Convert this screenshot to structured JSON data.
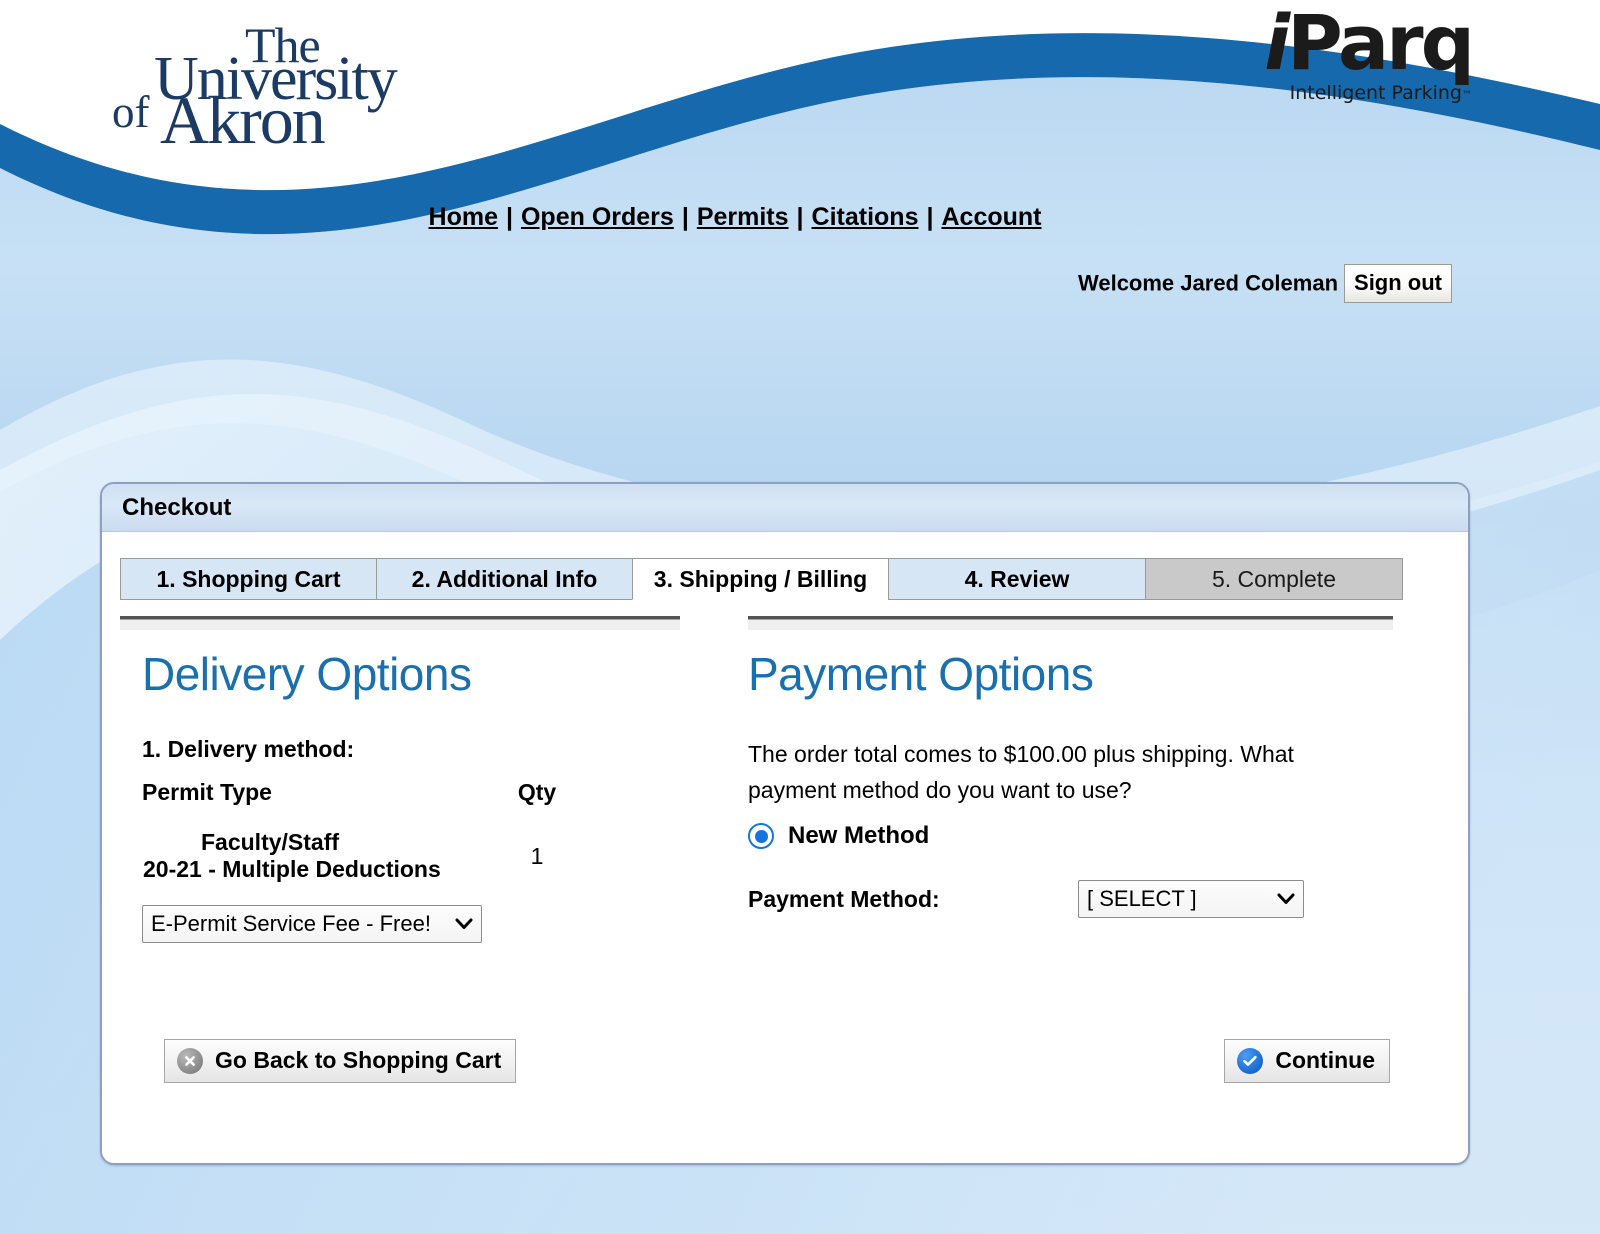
{
  "brand": {
    "university_logo": {
      "line1": "The",
      "line2": "University",
      "line3_of": "of",
      "line3": "Akron",
      "color": "#1b3a64"
    },
    "iparq_logo": {
      "name_i": "i",
      "name_rest": "Parq",
      "tagline": "Intelligent Parking",
      "tm": "™",
      "color": "#1b1b1b"
    }
  },
  "nav": {
    "separator": "|",
    "links": [
      {
        "label": "Home"
      },
      {
        "label": "Open Orders"
      },
      {
        "label": "Permits"
      },
      {
        "label": "Citations"
      },
      {
        "label": "Account"
      }
    ]
  },
  "account_bar": {
    "welcome": "Welcome Jared Coleman",
    "sign_out": "Sign out"
  },
  "panel": {
    "title": "Checkout"
  },
  "tabs": [
    {
      "label": "1. Shopping Cart",
      "state": "available"
    },
    {
      "label": "2. Additional Info",
      "state": "available"
    },
    {
      "label": "3. Shipping / Billing",
      "state": "active"
    },
    {
      "label": "4. Review",
      "state": "available"
    },
    {
      "label": "5. Complete",
      "state": "disabled"
    }
  ],
  "delivery": {
    "heading": "Delivery Options",
    "step_label": "1. Delivery method:",
    "columns": {
      "permit_type": "Permit Type",
      "qty": "Qty"
    },
    "rows": [
      {
        "permit_type_sub": "Faculty/Staff",
        "permit_type": "20-21 - Multiple Deductions",
        "qty": "1"
      }
    ],
    "shipping_select": {
      "value": "E-Permit Service Fee - Free!",
      "options": [
        "E-Permit Service Fee - Free!"
      ],
      "chevron": "⌄"
    }
  },
  "payment": {
    "heading": "Payment Options",
    "order_total_text": "The order total comes to $100.00 plus shipping. What payment method do you want to use?",
    "order_total": "$100.00",
    "method_choice": {
      "label": "New Method",
      "selected": true
    },
    "method_label": "Payment Method:",
    "method_select": {
      "value": "[ SELECT ]",
      "options": [
        "[ SELECT ]"
      ],
      "chevron": "⌄"
    }
  },
  "footer": {
    "back_button": "Go Back to Shopping Cart",
    "continue_button": "Continue"
  },
  "colors": {
    "wave_blue": "#1569ac",
    "panel_border": "#8e9fc4",
    "heading_blue": "#1a6faf",
    "tab_blue": "#d7e6f4",
    "tab_disabled": "#c9c9c9",
    "radio_blue": "#1374e0"
  }
}
